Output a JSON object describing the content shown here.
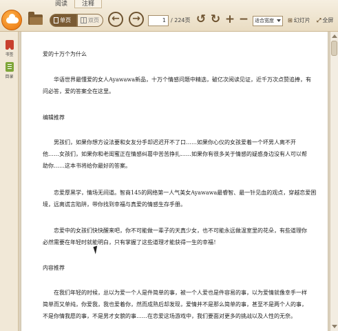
{
  "tabs": [
    {
      "label": "阅读",
      "active": false
    },
    {
      "label": "注释",
      "active": true
    }
  ],
  "toolbar": {
    "single_page_label": "单页",
    "double_page_label": "双页",
    "current_page": "1",
    "total_pages": "/ 224页",
    "fit_mode": "适合宽度",
    "slideshow_label": "幻灯片",
    "fullscreen_label": "全屏"
  },
  "sidebar": {
    "bookmark_label": "书签",
    "toc_label": "目录"
  },
  "document": {
    "paragraphs": [
      [
        "爱的十万个为什么"
      ],
      [
        "华语世界最懂爱的女人Ayawawa新品，十万个情感问题中精选，破亿次阅读见证，近千万次点赞追捧，有",
        "问必答，爱的答案全在这里。"
      ],
      [
        "编辑推荐"
      ],
      [
        "男孩们，如果你想方设法要和女友分手却迟迟开不了口……如果你心仪的女孩爱着一个坏男人离不开",
        "他……女孩们，如果你和老闺蜜正在情感纠葛中苦苦挣扎……如果你有很多关于情感的疑惑身边没有人可以帮",
        "助你……这本书将给你最好的答案。"
      ],
      [
        "恋爱厚黑学，情场无间道。智商145的网络第一人气美女Ayawawa最睿智、最一针见血的观点，穿越恋爱困",
        "境，远离谎言陷阱，带你找到幸福与真爱的情感生存手册。"
      ],
      [
        "恋爱中的女孩们快快醒来吧，你不可能做一辈子的天真少女，也不可能永远做温室里的花朵，有些道理你",
        "必然需要在年轻时就能明白，只有掌握了这些道理才能获得一生的幸福！"
      ],
      [
        "内容推荐"
      ],
      [
        "在我们年轻的时候，总以为爱一个人是件简单的事，被一个人爱也是件容易的事，以为爱情就像幸手一样",
        "简单而又单纯，你爱我，我也爱着你，然而成熟后却发现，爱情并不是那么简单的事，甚至不是两个人的事，",
        "不是你情我愿的事，不是男才女貌的事……在恋爱这场游戏中，我们要面对更多的挑战以及人性的无奈。"
      ]
    ]
  },
  "colors": {
    "accent": "#7a5b34",
    "header_bg": "#efe6d4",
    "bookmark": "#c8402e",
    "toc": "#7fa63a"
  }
}
